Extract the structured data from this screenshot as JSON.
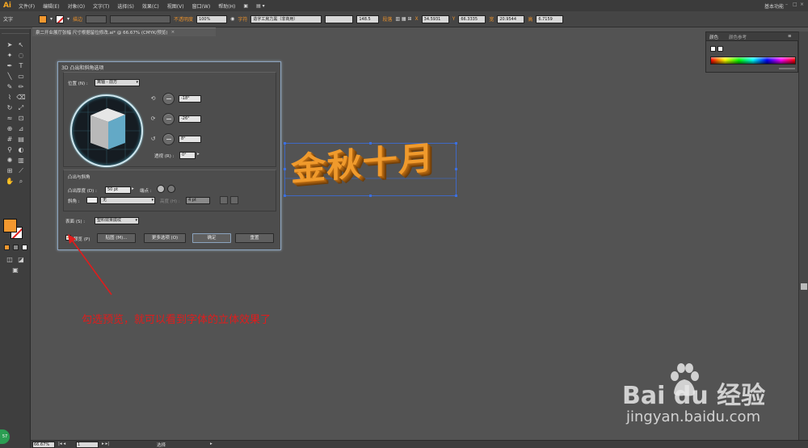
{
  "app": {
    "logo": "Ai",
    "menu": [
      "文件(F)",
      "编辑(E)",
      "对象(O)",
      "文字(T)",
      "选择(S)",
      "效果(C)",
      "视图(V)",
      "窗口(W)",
      "帮助(H)"
    ],
    "workspace": "基本功能"
  },
  "control_bar": {
    "tool_name": "文字",
    "stroke_label": "描边",
    "opacity_label": "不透明度",
    "opacity_value": "100%",
    "char_label": "字符",
    "font_value": "造字工房力黑（非商用）",
    "size_value": "148.5",
    "align_label": "段落",
    "x_label": "X",
    "x_value": "34.5931",
    "y_label": "Y",
    "y_value": "66.3335",
    "w_label": "宽",
    "w_value": "20.9544",
    "h_label": "高",
    "h_value": "6.7159"
  },
  "document": {
    "tab_title": "泉二开业展厅张幅 尺寸根据留位修改.ai* @ 66.67% (CMYK/预览)",
    "close": "×",
    "artwork_text": "金秋十月"
  },
  "dialog": {
    "title": "3D 凸出和斜角选项",
    "position_label": "位置 (N) :",
    "position_value": "离轴 - 前方",
    "rot_x": "-18°",
    "rot_y": "-26°",
    "rot_z": "8°",
    "perspective_label": "透视 (R) :",
    "perspective_value": "0°",
    "extrude_group": "凸出与斜角",
    "depth_label": "凸出厚度 (D) :",
    "depth_value": "50 pt",
    "cap_label": "端点 :",
    "bevel_label": "斜角 :",
    "bevel_value": "无",
    "height_label": "高度 (H) :",
    "height_value": "4 pt",
    "surface_label": "表面 (S) :",
    "surface_value": "塑料效果底纹",
    "preview_label": "预览 (P)",
    "preview_checked": true,
    "map_button": "贴图 (M)...",
    "more_button": "更多选项 (O)",
    "ok_button": "确定",
    "reset_button": "重置"
  },
  "color_panel": {
    "tab1": "颜色",
    "tab2": "颜色参考"
  },
  "annotation": "勾选预览，就可以看到字体的立体效果了",
  "status_bar": {
    "zoom": "66.67%",
    "page": "1",
    "mode": "选择"
  },
  "watermark": {
    "logo": "Bai  du 经验",
    "url": "jingyan.baidu.com"
  },
  "side_badge": "57",
  "colors": {
    "accent": "#f2982f",
    "annotation": "#e01c1c",
    "selection": "#3b6fe0"
  }
}
